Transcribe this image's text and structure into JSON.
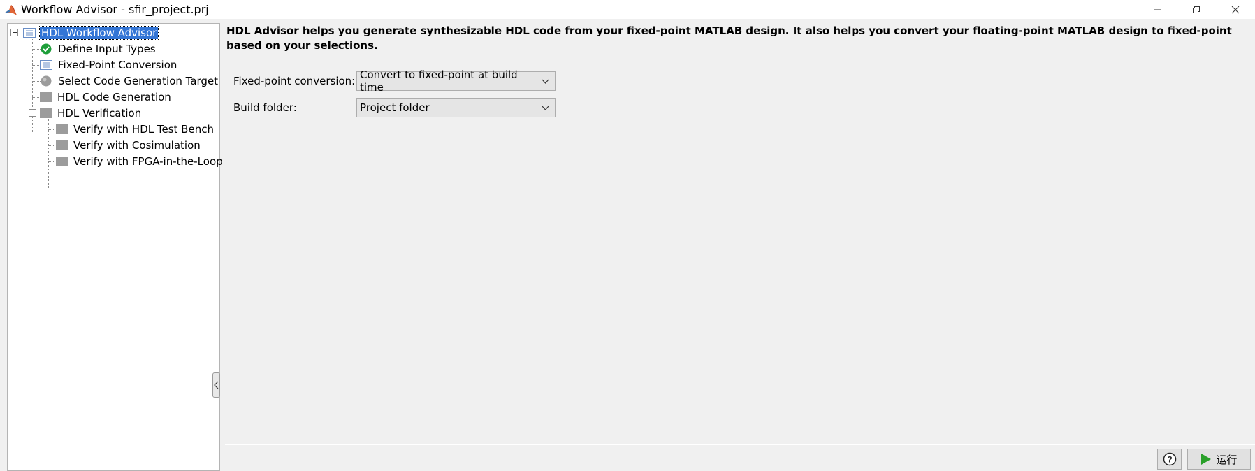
{
  "window": {
    "title": "Workflow Advisor - sfir_project.prj",
    "controls": {
      "minimize": "minimize-icon",
      "restore": "restore-icon",
      "close": "close-icon"
    }
  },
  "tree": {
    "items": [
      {
        "label": "HDL Workflow Advisor",
        "icon": "document-icon",
        "state": "selected"
      },
      {
        "label": "Define Input Types",
        "icon": "check-circle-icon",
        "state": "completed"
      },
      {
        "label": "Fixed-Point Conversion",
        "icon": "document-icon",
        "state": "pending"
      },
      {
        "label": "Select Code Generation Target",
        "icon": "gray-circle-icon",
        "state": "not-run"
      },
      {
        "label": "HDL Code Generation",
        "icon": "gray-square-icon",
        "state": "disabled"
      },
      {
        "label": "HDL Verification",
        "icon": "gray-square-icon",
        "state": "disabled"
      },
      {
        "label": "Verify with HDL Test Bench",
        "icon": "gray-square-icon",
        "state": "disabled"
      },
      {
        "label": "Verify with Cosimulation",
        "icon": "gray-square-icon",
        "state": "disabled"
      },
      {
        "label": "Verify with FPGA-in-the-Loop",
        "icon": "gray-square-icon",
        "state": "disabled"
      }
    ]
  },
  "main": {
    "intro": "HDL Advisor helps you generate synthesizable HDL code from your fixed-point MATLAB design. It also helps you convert your floating-point MATLAB design to fixed-point based on your selections.",
    "fixed_point": {
      "label": "Fixed-point conversion:",
      "value": "Convert to fixed-point at build time"
    },
    "build_folder": {
      "label": "Build folder:",
      "value": "Project folder"
    }
  },
  "footer": {
    "help_icon": "help-icon",
    "run_label": "运行",
    "run_icon": "play-icon"
  },
  "colors": {
    "selection": "#3375d6",
    "check": "#1e9e3a",
    "run_arrow": "#2aa02a"
  }
}
